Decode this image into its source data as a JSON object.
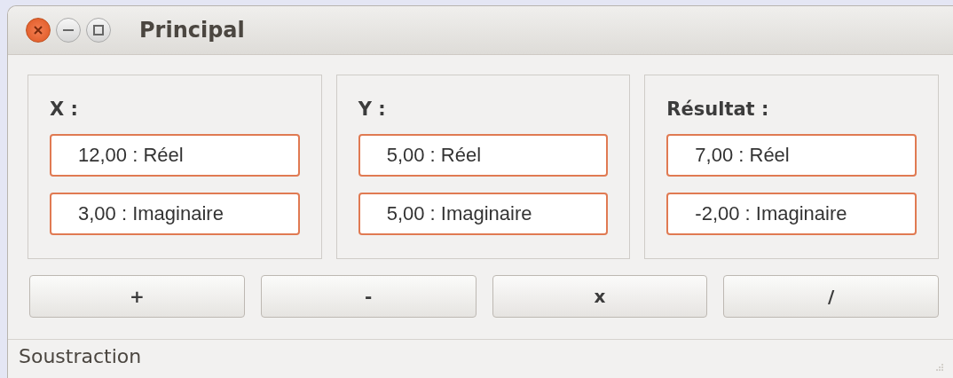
{
  "window": {
    "title": "Principal"
  },
  "panels": [
    {
      "label": "X :",
      "fields": [
        {
          "value": "12,00 : Réel"
        },
        {
          "value": "3,00 : Imaginaire"
        }
      ]
    },
    {
      "label": "Y :",
      "fields": [
        {
          "value": "5,00 : Réel"
        },
        {
          "value": "5,00 : Imaginaire"
        }
      ]
    },
    {
      "label": "Résultat :",
      "fields": [
        {
          "value": "7,00 : Réel"
        },
        {
          "value": "-2,00 : Imaginaire"
        }
      ]
    }
  ],
  "buttons": [
    "+",
    "-",
    "x",
    "/"
  ],
  "status_bar": "Soustraction"
}
